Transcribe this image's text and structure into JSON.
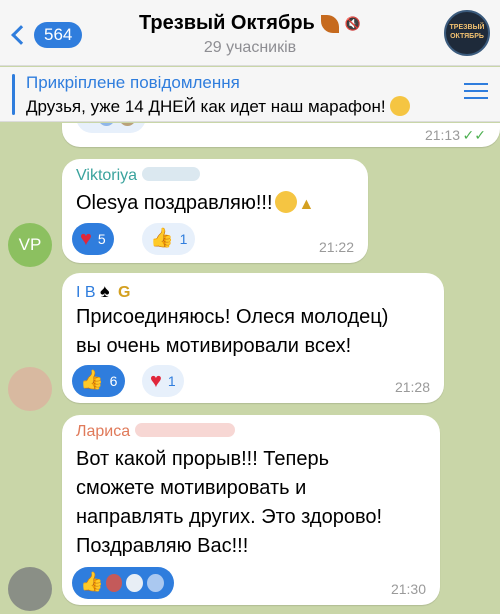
{
  "header": {
    "back_count": "564",
    "title": "Трезвый Октябрь",
    "subtitle": "29 учасників",
    "avatar_text": "ТРЕЗВЫЙ ОКТЯБРЬ"
  },
  "pinned": {
    "title": "Прикріплене повідомлення",
    "text": "Друзья, уже 14 ДНЕЙ как идет наш марафон!"
  },
  "messages": [
    {
      "time": "21:13"
    },
    {
      "sender": "Viktoriya",
      "text": "Olesya поздравляю!!!",
      "avatar_initials": "VP",
      "reactions": [
        {
          "icon": "heart-icon",
          "count": "5"
        },
        {
          "icon": "thumbs-up-icon",
          "count": "1"
        }
      ],
      "time": "21:22"
    },
    {
      "sender": "I B",
      "sender_suffix": "G",
      "lines": [
        "Присоединяюсь! Олеся молодец)",
        "вы очень мотивировали всех!"
      ],
      "reactions": [
        {
          "icon": "thumbs-up-icon",
          "count": "6"
        },
        {
          "icon": "heart-icon",
          "count": "1"
        }
      ],
      "time": "21:28"
    },
    {
      "sender": "Лариса",
      "lines": [
        "Вот какой прорыв!!! Теперь",
        "сможете мотивировать и",
        "направлять других. Это здорово!",
        "Поздравляю Вас!!!"
      ],
      "time": "21:30"
    }
  ],
  "colors": {
    "accent": "#2f7ddd",
    "sender1": "#3aa39d",
    "sender2": "#2f7ddd",
    "sender3": "#e07a5a"
  }
}
